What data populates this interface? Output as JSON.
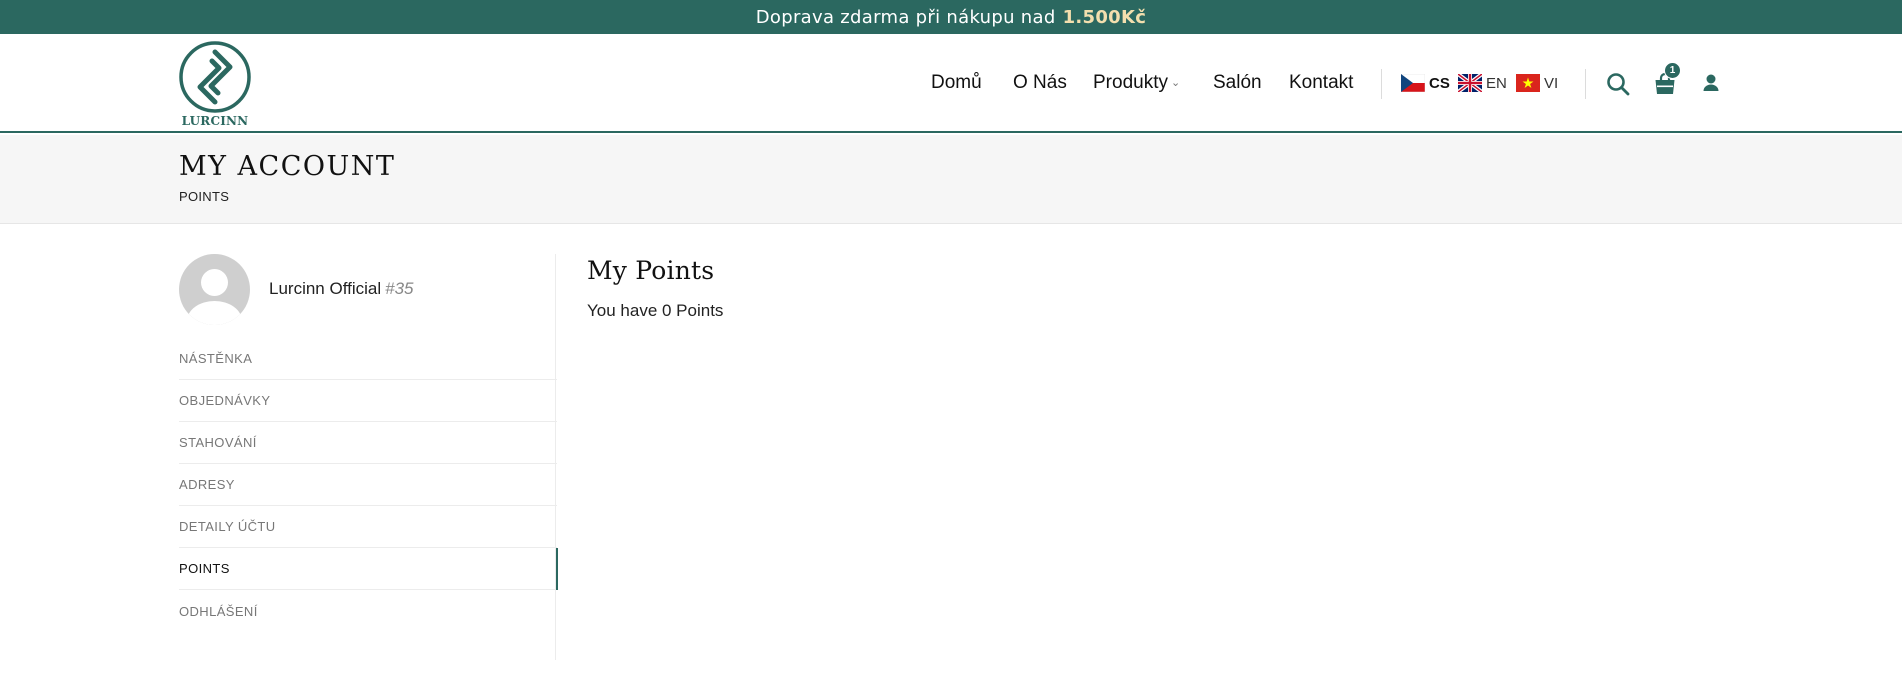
{
  "topbar": {
    "text": "Doprava zdarma při nákupu nad",
    "amount": "1.500Kč"
  },
  "logo": {
    "text": "LURCINN",
    "icon": "lurcinn-logo"
  },
  "nav": {
    "items": [
      {
        "label": "Domů"
      },
      {
        "label": "O Nás"
      },
      {
        "label": "Produkty",
        "caret": "⌄"
      },
      {
        "label": "Salón"
      },
      {
        "label": "Kontakt"
      }
    ]
  },
  "languages": [
    {
      "code": "CS",
      "flag": "czech-flag-icon",
      "active": true
    },
    {
      "code": "EN",
      "flag": "uk-flag-icon",
      "active": false
    },
    {
      "code": "VI",
      "flag": "vietnam-flag-icon",
      "active": false
    }
  ],
  "header_icons": {
    "search": "search-icon",
    "cart": "shopping-bag-icon",
    "account": "user-icon",
    "cart_count": "1"
  },
  "colors": {
    "brand": "#2b6860",
    "accent": "#f3dfae"
  },
  "page": {
    "title": "MY ACCOUNT",
    "breadcrumb": "POINTS"
  },
  "profile": {
    "name": "Lurcinn Official",
    "id": "#35"
  },
  "menu": {
    "items": [
      {
        "label": "NÁSTĚNKA"
      },
      {
        "label": "OBJEDNÁVKY"
      },
      {
        "label": "STAHOVÁNÍ"
      },
      {
        "label": "ADRESY"
      },
      {
        "label": "DETAILY ÚČTU"
      },
      {
        "label": "POINTS",
        "active": true
      },
      {
        "label": "ODHLÁŠENÍ"
      }
    ]
  },
  "content": {
    "title": "My Points",
    "text": "You have 0 Points"
  }
}
